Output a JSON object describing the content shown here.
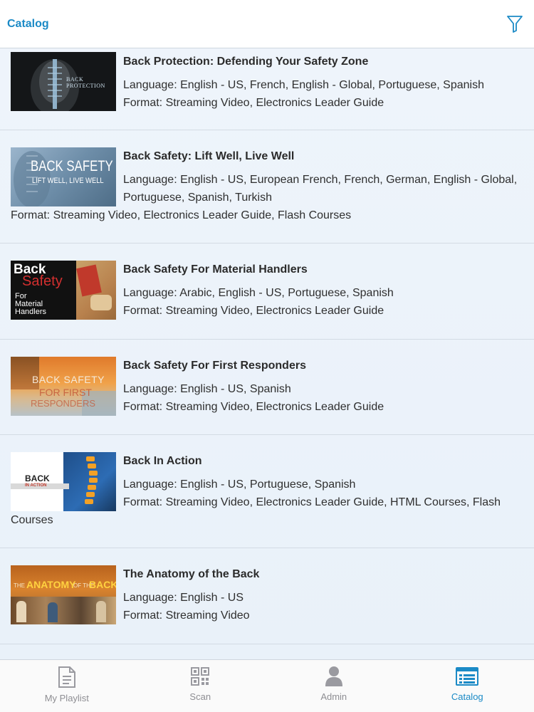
{
  "header": {
    "title": "Catalog"
  },
  "items": [
    {
      "title": "Back Protection: Defending Your Safety Zone",
      "language": "Language: English - US, French, English - Global, Portuguese, Spanish",
      "format": "Format: Streaming Video, Electronics Leader Guide",
      "thumb_text": "BACK PROTECTION"
    },
    {
      "title": "Back Safety: Lift Well, Live Well",
      "language_line1": "Language: English - US, European French, French, German, English - Global,",
      "language_line2": "Portuguese, Spanish, Turkish",
      "format": "Format: Streaming Video, Electronics Leader Guide, Flash Courses",
      "thumb_text1": "BACK SAFETY",
      "thumb_text2": "LIFT WELL, LIVE WELL"
    },
    {
      "title": "Back Safety For Material Handlers",
      "language": "Language: Arabic, English - US, Portuguese, Spanish",
      "format": "Format: Streaming Video, Electronics Leader Guide",
      "thumb_text1": "Back",
      "thumb_text2": "Safety",
      "thumb_text3": "For",
      "thumb_text4": "Material",
      "thumb_text5": "Handlers"
    },
    {
      "title": "Back Safety For First Responders",
      "language": "Language: English - US, Spanish",
      "format": "Format: Streaming Video, Electronics Leader Guide",
      "thumb_text1": "BACK SAFETY",
      "thumb_text2": "FOR FIRST",
      "thumb_text3": "RESPONDERS"
    },
    {
      "title": "Back In Action",
      "language": "Language: English - US, Portuguese, Spanish",
      "format_line1": "Format: Streaming Video, Electronics Leader Guide, HTML Courses, Flash",
      "format_line2": "Courses",
      "thumb_text1": "BACK",
      "thumb_text2": "IN ACTION"
    },
    {
      "title": "The Anatomy of the Back",
      "language": "Language: English - US",
      "format": "Format: Streaming Video",
      "thumb_text1": "THE",
      "thumb_text2": "ANATOMY",
      "thumb_text3": "OF THE",
      "thumb_text4": "BACK"
    }
  ],
  "tabs": [
    {
      "label": "My Playlist",
      "icon": "document-icon",
      "active": false
    },
    {
      "label": "Scan",
      "icon": "qr-code-icon",
      "active": false
    },
    {
      "label": "Admin",
      "icon": "person-icon",
      "active": false
    },
    {
      "label": "Catalog",
      "icon": "catalog-icon",
      "active": true
    }
  ],
  "colors": {
    "accent": "#1b8ac6",
    "tab_inactive": "#8e8e93",
    "list_bg": "#eaf1f9"
  }
}
